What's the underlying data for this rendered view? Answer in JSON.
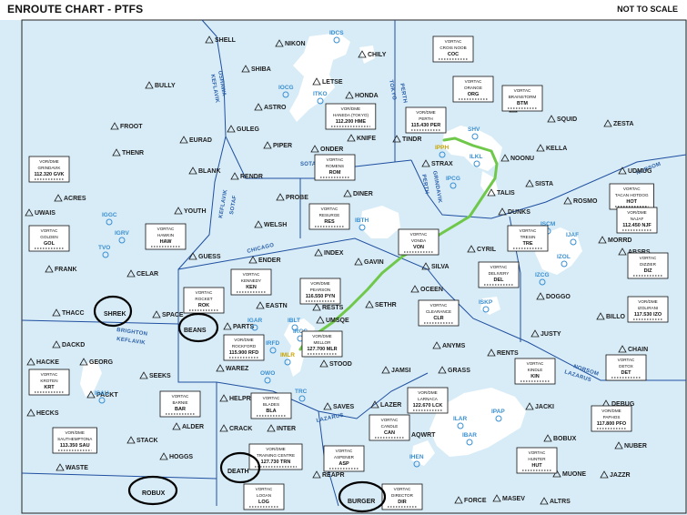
{
  "header": {
    "title": "ENROUTE CHART - PTFS",
    "scale_note": "NOT TO SCALE"
  },
  "colors": {
    "water": "#d8ecf7",
    "land": "#ffffff",
    "boundary": "#1f4fa0",
    "route": "#6fc84a",
    "fix": "#1b1b1b",
    "airport_blue": "#3a8fd0",
    "highlight_circle": "#000000"
  },
  "fixes": [
    "SHELL",
    "NIKON",
    "CHILY",
    "BULLY",
    "SHIBA",
    "LETSE",
    "HONDA",
    "ASTRO",
    "FROOT",
    "GULEG",
    "EURAD",
    "PIPER",
    "ONDER",
    "KNIFE",
    "TINDR",
    "WELLS",
    "SQUID",
    "ZESTA",
    "KELLA",
    "STRAX",
    "NOONU",
    "THENR",
    "BLANK",
    "RENDR",
    "DINER",
    "TALIS",
    "SISTA",
    "UDMUG",
    "ACRES",
    "PROBE",
    "ROSMO",
    "UWAIS",
    "YOUTH",
    "WELSH",
    "DUNKS",
    "MORRD",
    "GUESS",
    "INDEX",
    "GAVIN",
    "CYRIL",
    "ABSRS",
    "FRANK",
    "CELAR",
    "ENDER",
    "SILVA",
    "OCEEN",
    "DOGGO",
    "THACC",
    "EASTN",
    "RESTS",
    "SETHR",
    "BILLO",
    "SPACE",
    "PARTS",
    "UMSQE",
    "JUSTY",
    "DACKD",
    "ANYMS",
    "RENTS",
    "CHAIN",
    "HACKE",
    "GEORG",
    "SEEKS",
    "WAREZ",
    "STOOD",
    "JAMSI",
    "GRASS",
    "HELPR",
    "JACKI",
    "HECKS",
    "PACKT",
    "LAZER",
    "DEBUG",
    "ALDER",
    "CRACK",
    "INTER",
    "SAVES",
    "AQWRT",
    "STACK",
    "BOBUX",
    "NUBER",
    "HOGGS",
    "WASTE",
    "REAPR",
    "MUONE",
    "JAZZR",
    "FORIA",
    "FORCE",
    "MASEV",
    "ALTRS"
  ],
  "airports": [
    "IDCS",
    "IOCG",
    "ITKO",
    "IPPH",
    "ILKL",
    "SHV",
    "IPCG",
    "IGGC",
    "IGRV",
    "TVO",
    "IBTH",
    "ISCM",
    "IJAF",
    "IZOL",
    "IZCG",
    "ISKP",
    "IGAR",
    "IBLT",
    "IRFD",
    "IRCG",
    "IMLR",
    "OWO",
    "TRC",
    "ISAU",
    "IBAR",
    "ILAR",
    "IHEN",
    "IPAP"
  ],
  "airspace_labels": [
    "OSHAWA",
    "KEFLAVIK",
    "TOKYO",
    "PERTH",
    "SOTAF",
    "KEFLAVIK",
    "SOTAF",
    "PERTH",
    "GRINDAVIK",
    "NORSOM",
    "BRIGHTON",
    "NORSOM",
    "LAZARUS",
    "CHICAGO",
    "LAZARUS",
    "KEFLAVIK"
  ],
  "navaids": [
    {
      "type": "VORTAC",
      "name": "CROIS NOOB",
      "id": "COC"
    },
    {
      "type": "VORTAC",
      "name": "ORANGE",
      "id": "ORG"
    },
    {
      "type": "VORTAC",
      "name": "BRAINSTORM",
      "id": "BTM"
    },
    {
      "type": "VOR/DME",
      "name": "PERTH",
      "freq": "115.430 PER"
    },
    {
      "type": "VOR/DME",
      "name": "HANEDA (TOKYO)",
      "freq": "112.200 HME"
    },
    {
      "type": "VOR/DME",
      "name": "GRINDAVIK",
      "freq": "112.320 GVK"
    },
    {
      "type": "VORTAC",
      "name": "ROMENS",
      "id": "ROM"
    },
    {
      "type": "VORTAC",
      "name": "RESURGE",
      "id": "RES"
    },
    {
      "type": "VORTAC",
      "name": "GOLDEN",
      "id": "GOL"
    },
    {
      "type": "VORTAC",
      "name": "HAWKIN",
      "id": "HAW"
    },
    {
      "type": "VORTAC",
      "name": "TACAN HOTDOG",
      "id": "HOT"
    },
    {
      "type": "VOR/DME",
      "name": "NAJAF",
      "freq": "112.450 NJF"
    },
    {
      "type": "VORTAC",
      "name": "TRESIN",
      "id": "TRE"
    },
    {
      "type": "VORTAC",
      "name": "VONDA",
      "id": "VON"
    },
    {
      "type": "VORTAC",
      "name": "KENNEDY",
      "id": "KEN"
    },
    {
      "type": "VORTAC",
      "name": "DIZZIER",
      "id": "DIZ"
    },
    {
      "type": "VORTAC",
      "name": "DELIVERY",
      "id": "DEL"
    },
    {
      "type": "VORTAC",
      "name": "ROCKET",
      "id": "ROK"
    },
    {
      "type": "VOR/DME",
      "name": "PEARSON",
      "freq": "116.550 PYN"
    },
    {
      "type": "VOR/DME",
      "name": "IZOLIRANI",
      "freq": "117.530 IZO"
    },
    {
      "type": "VORTAC",
      "name": "CLEARANCE",
      "id": "CLR"
    },
    {
      "type": "VOR/DME",
      "name": "ROCKFORD",
      "freq": "115.900 RFD"
    },
    {
      "type": "VOR/DME",
      "name": "MELLOR",
      "freq": "127.700 MLR"
    },
    {
      "type": "VORTAC",
      "name": "DETOX",
      "id": "DET"
    },
    {
      "type": "VORTAC",
      "name": "KINDLE",
      "id": "KIN"
    },
    {
      "type": "VORTAC",
      "name": "KROTEN",
      "id": "KRT"
    },
    {
      "type": "VORTAC",
      "name": "BARNIE",
      "id": "BAR"
    },
    {
      "type": "VORTAC",
      "name": "BLADES",
      "id": "BLA"
    },
    {
      "type": "VOR/DME",
      "name": "LARNACA",
      "freq": "122.670 LCK"
    },
    {
      "type": "VOR/DME",
      "name": "PAPHOS",
      "freq": "117.800 PFO"
    },
    {
      "type": "VORTAC",
      "name": "CANDLE",
      "id": "CAN"
    },
    {
      "type": "VOR/DME",
      "name": "SAUTHEMPTONA",
      "freq": "113.350 SAU"
    },
    {
      "type": "VOR/DME",
      "name": "TRAINING CENTRE",
      "freq": "127.730 TRN"
    },
    {
      "type": "VORTAC",
      "name": "ASPENER",
      "id": "ASP"
    },
    {
      "type": "VORTAC",
      "name": "HUNTER",
      "id": "HUT"
    },
    {
      "type": "VORTAC",
      "name": "LOGAN",
      "id": "LOG"
    },
    {
      "type": "VORTAC",
      "name": "DIRECTOR",
      "id": "DIR"
    }
  ],
  "annotations": [
    "SHREK",
    "BEANS",
    "ROBUX",
    "DEATH",
    "BURGER"
  ]
}
